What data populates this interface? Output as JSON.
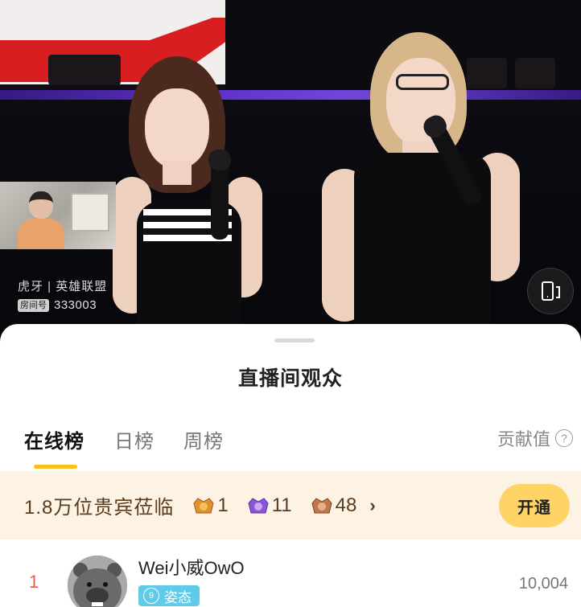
{
  "stream": {
    "channel_label": "虎牙 | 英雄联盟",
    "room_tag": "房间号",
    "room_number": "333003"
  },
  "sheet": {
    "title": "直播间观众",
    "tabs": [
      {
        "label": "在线榜",
        "active": true
      },
      {
        "label": "日榜",
        "active": false
      },
      {
        "label": "周榜",
        "active": false
      }
    ],
    "contribution_label": "贡献值",
    "help_icon": "?"
  },
  "vip": {
    "text": "1.8万位贵宾莅临",
    "badges": [
      {
        "icon": "gold-noble-badge",
        "count": "1",
        "color": "#e0902e"
      },
      {
        "icon": "purple-noble-badge",
        "count": "11",
        "color": "#8a55d8"
      },
      {
        "icon": "bronze-noble-badge",
        "count": "48",
        "color": "#c0764a"
      }
    ],
    "chevron": "›",
    "open_label": "开通"
  },
  "leaderboard": [
    {
      "rank": "1",
      "name": "Wei小威OwO",
      "level": "9",
      "tag": "姿态",
      "score": "10,004"
    }
  ],
  "colors": {
    "accent": "#ffbe1a",
    "vip_bg": "#fdf3e4",
    "open_btn": "#ffd466",
    "rank_red": "#e45a4e",
    "tag_blue": "#5fcbe8"
  }
}
